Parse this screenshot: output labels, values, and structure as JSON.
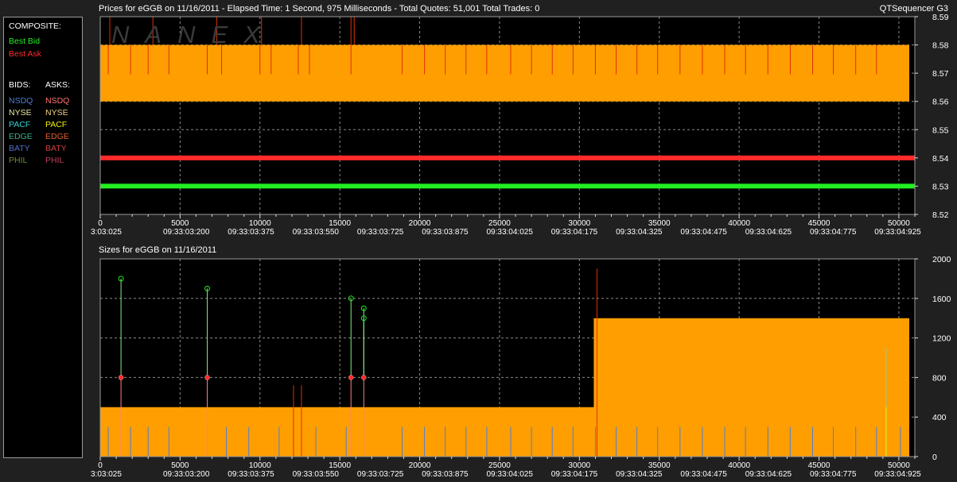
{
  "window": {
    "title": "Prices for  eGGB  on  11/16/2011   -  Elapsed Time: 1 Second, 975 Milliseconds   -  Total Quotes: 51,001   Total Trades: 0",
    "app_name": "QTSequencer G3",
    "watermark": "NANEX"
  },
  "legend": {
    "composite_header": "COMPOSITE:",
    "best_bid": "Best Bid",
    "best_ask": "Best Ask",
    "bids_header": "BIDS:",
    "asks_header": "ASKS:",
    "bids": [
      {
        "label": "NSDQ",
        "color": "#4f7fd4"
      },
      {
        "label": "NYSE",
        "color": "#e8e8a0"
      },
      {
        "label": "PACF",
        "color": "#33d6d6"
      },
      {
        "label": "EDGE",
        "color": "#3fae8a"
      },
      {
        "label": "BATY",
        "color": "#5070c8"
      },
      {
        "label": "PHIL",
        "color": "#6c8c3c"
      }
    ],
    "asks": [
      {
        "label": "NSDQ",
        "color": "#ff7070"
      },
      {
        "label": "NYSE",
        "color": "#f0d080"
      },
      {
        "label": "PACF",
        "color": "#f0f000"
      },
      {
        "label": "EDGE",
        "color": "#e06030"
      },
      {
        "label": "BATY",
        "color": "#d04040"
      },
      {
        "label": "PHIL",
        "color": "#c04060"
      }
    ],
    "colors": {
      "best_bid": "#22ee22",
      "best_ask": "#ff2b2b",
      "text": "#ffffff"
    }
  },
  "chart_data": [
    {
      "type": "line",
      "title": "Prices for  eGGB  on  11/16/2011   -  Elapsed Time: 1 Second, 975 Milliseconds   -  Total Quotes: 51,001   Total Trades: 0",
      "xlim": [
        0,
        51001
      ],
      "ylim": [
        8.52,
        8.59
      ],
      "x_ticks": [
        "0",
        "5000",
        "10000",
        "15000",
        "20000",
        "25000",
        "30000",
        "35000",
        "40000",
        "45000",
        "50000"
      ],
      "time_ticks": [
        "3:03:025",
        "09:33:03:200",
        "09:33:03:375",
        "09:33:03:550",
        "09:33:03:725",
        "09:33:03:875",
        "09:33:04:025",
        "09:33:04:175",
        "09:33:04:325",
        "09:33:04:475",
        "09:33:04:625",
        "09:33:04:775",
        "09:33:04:925"
      ],
      "y_ticks": [
        "8.59",
        "8.58",
        "8.57",
        "8.56",
        "8.55",
        "8.54",
        "8.53",
        "8.52"
      ],
      "grid": true,
      "colors": {
        "ask_band": "#ff9e00",
        "spike": "#e03000",
        "bid": "#22ee22",
        "ask": "#ff2b2b"
      },
      "series": [
        {
          "name": "Best Bid",
          "values": [
            [
              0,
              8.53
            ],
            [
              51001,
              8.53
            ]
          ]
        },
        {
          "name": "Best Ask",
          "values": [
            [
              0,
              8.54
            ],
            [
              51001,
              8.54
            ]
          ]
        }
      ],
      "ask_band": {
        "low": 8.56,
        "high": 8.58,
        "x_end": 51001
      },
      "band_spikes": [
        500,
        1900,
        3000,
        4300,
        6700,
        7600,
        10000,
        10700,
        12400,
        13100,
        15700,
        18900,
        20300,
        21600,
        22900,
        24200,
        25700,
        27000,
        28300,
        29600,
        31000,
        32300,
        33600,
        34900,
        36300,
        37700,
        39100,
        40400,
        41800,
        43200,
        44600,
        45900,
        47300,
        48600
      ],
      "upper_spikes": [
        600,
        3300,
        7300,
        10100,
        12600,
        15700,
        15900
      ]
    },
    {
      "type": "bar",
      "title": "Sizes for  eGGB  on  11/16/2011",
      "xlim": [
        0,
        51001
      ],
      "ylim": [
        0,
        2000
      ],
      "x_ticks": [
        "0",
        "5000",
        "10000",
        "15000",
        "20000",
        "25000",
        "30000",
        "35000",
        "40000",
        "45000",
        "50000"
      ],
      "time_ticks": [
        "3:03:025",
        "09:33:03:200",
        "09:33:03:375",
        "09:33:03:550",
        "09:33:03:725",
        "09:33:03:875",
        "09:33:04:025",
        "09:33:04:175",
        "09:33:04:325",
        "09:33:04:475",
        "09:33:04:625",
        "09:33:04:775",
        "09:33:04:925"
      ],
      "y_ticks": [
        "2000",
        "1600",
        "1200",
        "800",
        "400",
        "0"
      ],
      "grid": true,
      "colors": {
        "ask_size": "#ff9e00",
        "bid_line": "#80ee80",
        "ask_line": "#ff8080",
        "marker_bid": "#22ee22",
        "marker_ask": "#ff2b2b"
      },
      "ask_size_steps": [
        [
          0,
          500
        ],
        [
          30900,
          500
        ],
        [
          30900,
          1400
        ],
        [
          51001,
          1400
        ]
      ],
      "bid_spikes": [
        {
          "x": 1300,
          "size": 1800
        },
        {
          "x": 6700,
          "size": 1700
        },
        {
          "x": 15700,
          "size": 1600
        },
        {
          "x": 16500,
          "size": 1500
        },
        {
          "x": 16500,
          "size": 1400
        }
      ],
      "ask_markers": [
        {
          "x": 1300,
          "size": 800
        },
        {
          "x": 6700,
          "size": 800
        },
        {
          "x": 15700,
          "size": 800
        },
        {
          "x": 16500,
          "size": 800
        }
      ],
      "red_spikes": [
        {
          "x": 12100,
          "size": 720
        },
        {
          "x": 12600,
          "size": 720
        },
        {
          "x": 31100,
          "size": 1900
        }
      ],
      "small_spikes": [
        500,
        1900,
        3000,
        4300,
        6700,
        7900,
        9300,
        11200,
        13500,
        15400,
        18900,
        20300,
        21600,
        22900,
        24200,
        25700,
        27000,
        28300,
        29600,
        31000,
        32300,
        33600,
        34900,
        36300,
        37700,
        39100,
        40400,
        41800,
        43200,
        44600,
        45900,
        47300,
        48600,
        50100
      ],
      "late_spikes": [
        {
          "x": 49200,
          "size": 1100,
          "color": "#90d090"
        },
        {
          "x": 49200,
          "size": 500,
          "color": "#f0f000"
        }
      ]
    }
  ]
}
